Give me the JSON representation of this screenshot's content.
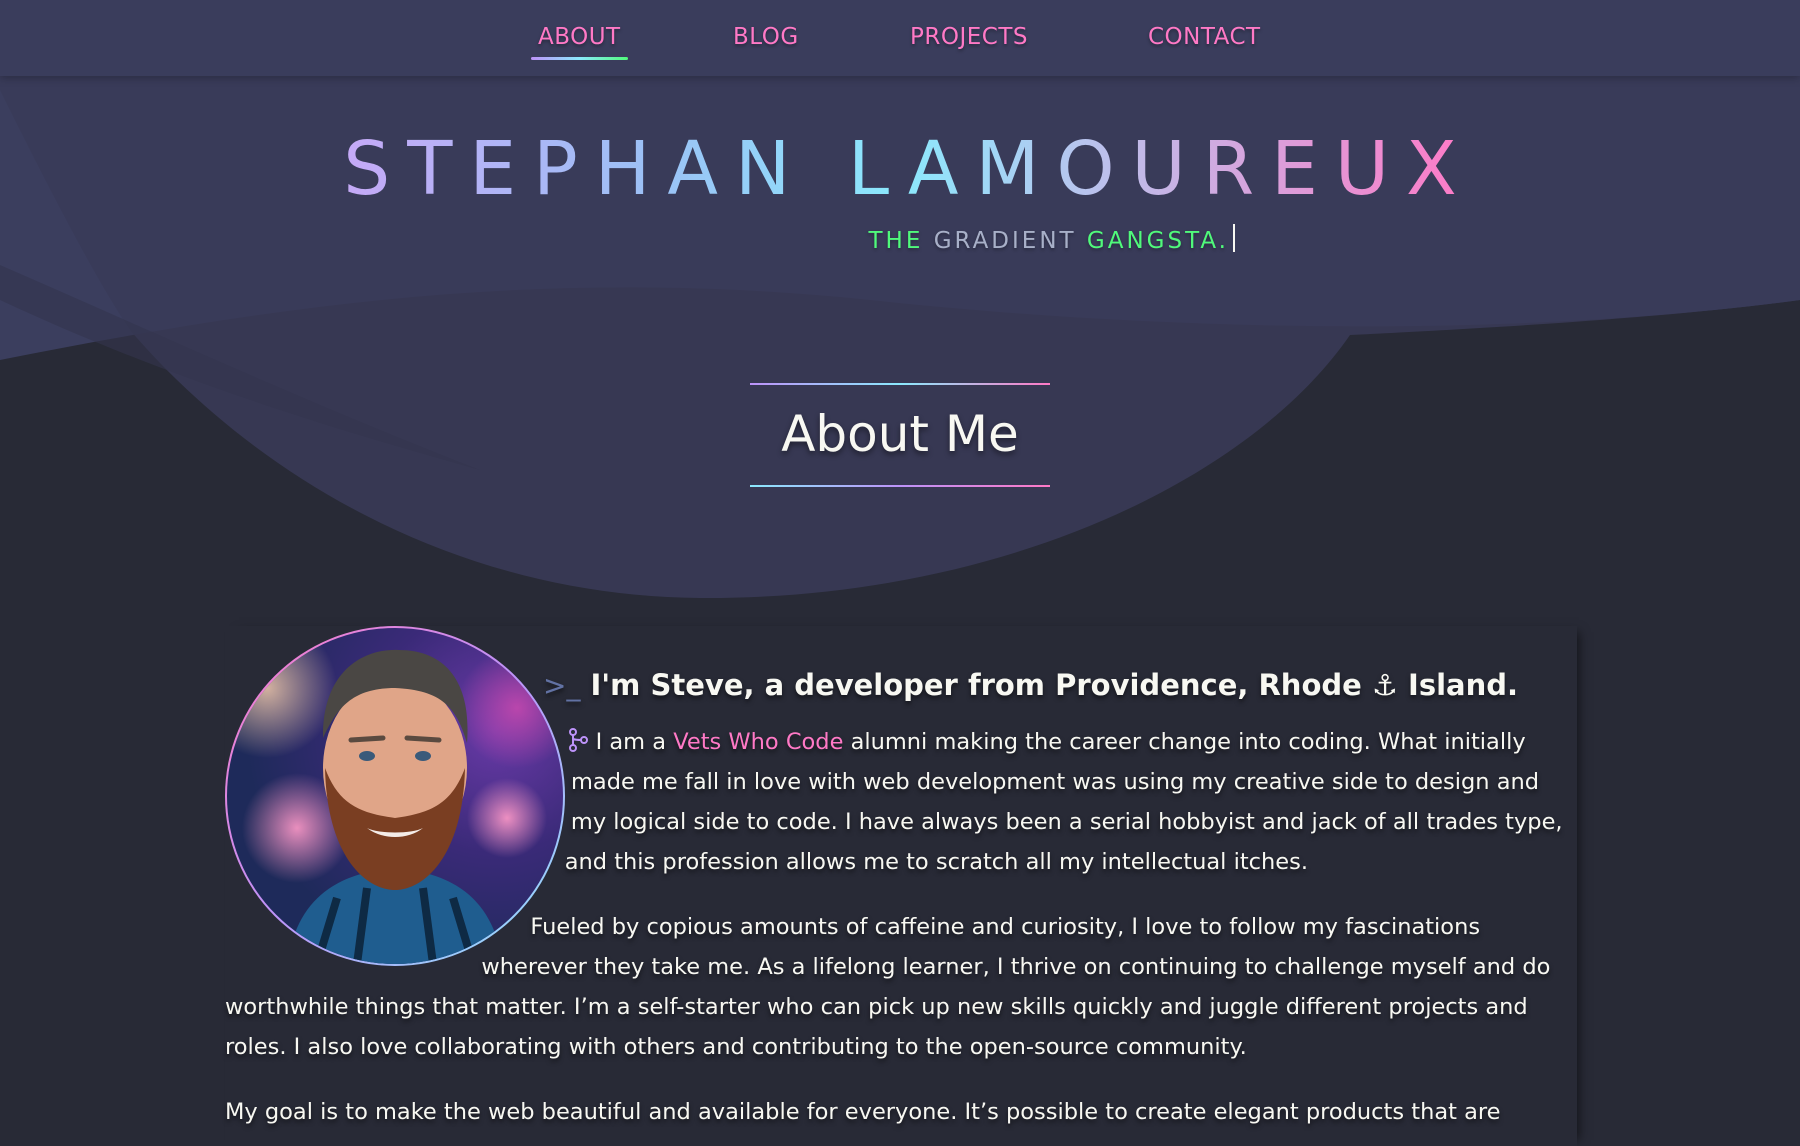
{
  "nav": {
    "items": [
      {
        "label": "ABOUT",
        "active": true
      },
      {
        "label": "BLOG",
        "active": false
      },
      {
        "label": "PROJECTS",
        "active": false
      },
      {
        "label": "CONTACT",
        "active": false
      }
    ]
  },
  "hero": {
    "name": "STEPHAN LAMOUREUX",
    "tagline": {
      "part1": "THE",
      "part2": "GRADIENT",
      "part3": "GANGSTA."
    }
  },
  "about": {
    "title": "About Me",
    "heading": "I'm Steve, a developer from Providence, Rhode",
    "heading_icon": "anchor-icon",
    "heading_end": "Island.",
    "paragraph1": {
      "prefix": "I am a",
      "link": "Vets Who Code",
      "rest": "alumni making the career change into coding. What initially made me fall in love with web development was using my creative side to design and my logical side to code. I have always been a serial hobbyist and jack of all trades type, and this profession allows me to scratch all my intellectual itches."
    },
    "paragraph2": "Fueled by copious amounts of caffeine and curiosity, I love to follow my fascinations wherever they take me. As a lifelong learner, I thrive on continuing to challenge myself and do worthwhile things that matter. I’m a self-starter who can pick up new skills quickly and juggle different projects and roles. I also love collaborating with others and contributing to the open-source community.",
    "paragraph3": "My goal is to make the web beautiful and available for everyone. It’s possible to create elegant products that are"
  },
  "colors": {
    "background": "#282a36",
    "nav_bg": "#3a3d5c",
    "pink": "#ff79c6",
    "green": "#50fa7b",
    "cyan": "#8be9fd",
    "purple": "#bd93f9"
  }
}
